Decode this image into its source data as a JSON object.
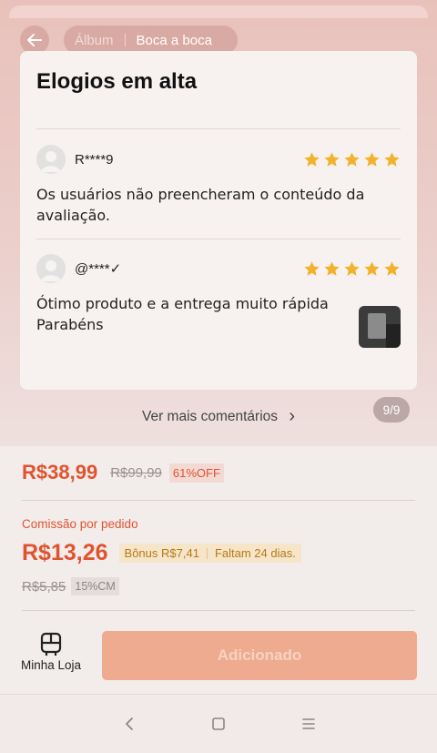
{
  "header": {
    "tabs": [
      {
        "label": "Álbum",
        "active": false
      },
      {
        "label": "Boca a boca",
        "active": true
      }
    ]
  },
  "reviews_section": {
    "title": "Elogios em alta",
    "reviews": [
      {
        "user": "R****9",
        "stars": 5,
        "text": "Os usuários não preencheram o conteúdo da avaliação.",
        "has_photo": false
      },
      {
        "user": "@****✓",
        "stars": 5,
        "text": "Ótimo  produto e a entrega muito rápida Parabéns",
        "has_photo": true
      }
    ],
    "more_link": "Ver mais comentários",
    "more_chevron": "›",
    "counter": "9/9"
  },
  "pricing": {
    "price": "R$38,99",
    "old_price": "R$99,99",
    "discount": "61%OFF",
    "commission_label": "Comissão por pedido",
    "commission": "R$13,26",
    "bonus": "Bônus R$7,41",
    "time_left": "Faltam 24 dias.",
    "old_commission": "R$5,85",
    "cm_rate": "15%CM"
  },
  "actions": {
    "store_label": "Minha Loja",
    "add_label": "Adicionado"
  },
  "colors": {
    "accent": "#e0532f",
    "star": "#f2b22c",
    "add_button": "#eeab8f"
  },
  "icons": {
    "back": "arrow-left",
    "store": "shop-icon",
    "nav": [
      "back-triangle",
      "home-square",
      "menu-lines"
    ]
  }
}
